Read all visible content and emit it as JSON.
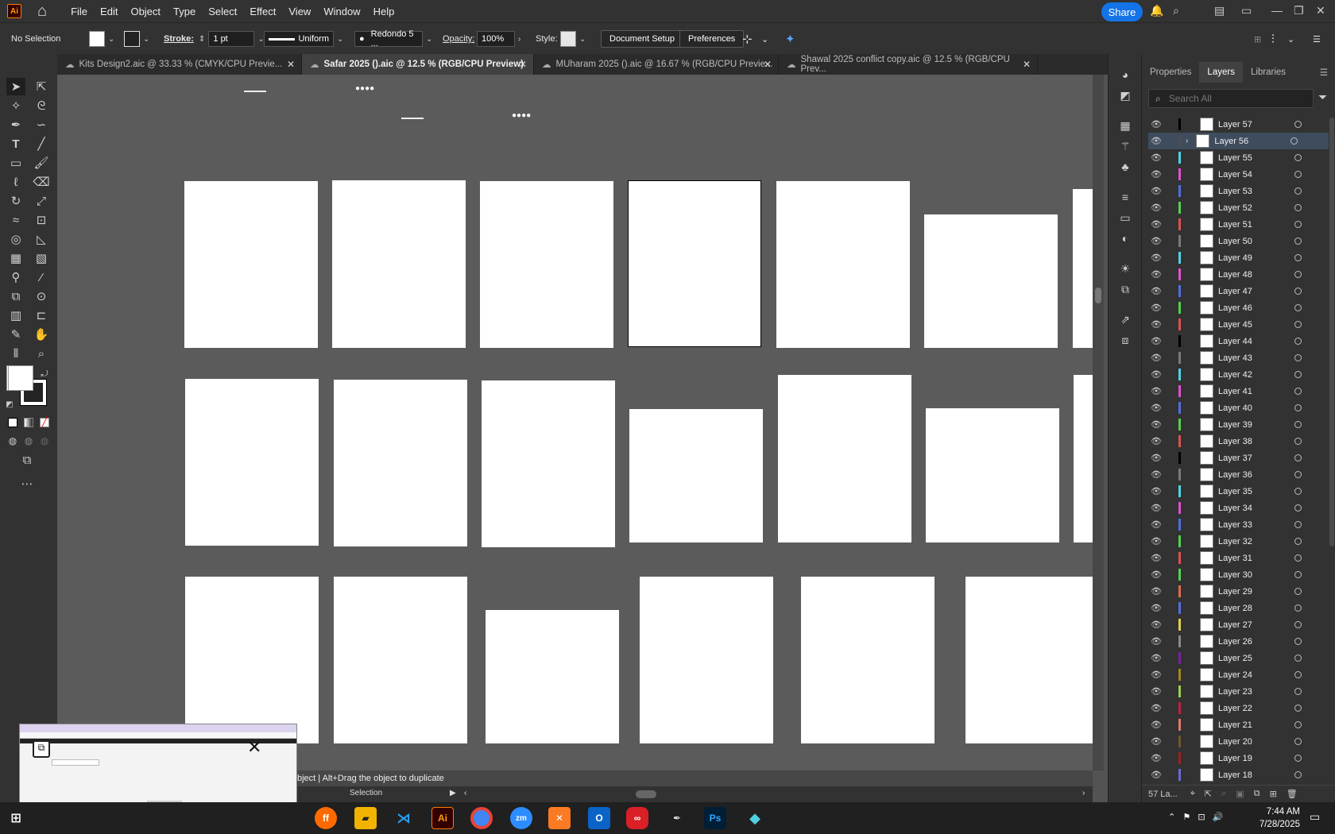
{
  "menubar": {
    "app_logo": "Ai",
    "items": [
      "File",
      "Edit",
      "Object",
      "Type",
      "Select",
      "Effect",
      "View",
      "Window",
      "Help"
    ],
    "share_label": "Share"
  },
  "control": {
    "selection": "No Selection",
    "stroke_label": "Stroke:",
    "stroke_value": "1 pt",
    "profile": "Uniform",
    "brush": "Redondo 5 ...",
    "opacity_label": "Opacity:",
    "opacity_value": "100%",
    "style_label": "Style:",
    "doc_setup": "Document Setup",
    "preferences": "Preferences"
  },
  "tabs": [
    {
      "label": "Kits Design2.aic @ 33.33 % (CMYK/CPU Previe...",
      "active": false
    },
    {
      "label": "Safar 2025 ().aic @ 12.5 % (RGB/CPU Preview)",
      "active": true
    },
    {
      "label": "MUharam 2025 ().aic @ 16.67 % (RGB/CPU Previe...",
      "active": false
    },
    {
      "label": "Shawal 2025 conflict copy.aic @ 12.5 % (RGB/CPU Prev...",
      "active": false
    }
  ],
  "panel": {
    "tabs": [
      "Properties",
      "Layers",
      "Libraries"
    ],
    "active_tab": "Layers",
    "search_placeholder": "Search All",
    "footer": "57 La...",
    "layers": [
      {
        "name": "Layer 57",
        "color": "#000000"
      },
      {
        "name": "Layer 56",
        "color": "#4d4d4d",
        "selected": true
      },
      {
        "name": "Layer 55",
        "color": "#4fd3e8"
      },
      {
        "name": "Layer 54",
        "color": "#e04fd3"
      },
      {
        "name": "Layer 53",
        "color": "#4f6fe0"
      },
      {
        "name": "Layer 52",
        "color": "#55d04f"
      },
      {
        "name": "Layer 51",
        "color": "#e04f4f"
      },
      {
        "name": "Layer 50",
        "color": "#7a7a7a"
      },
      {
        "name": "Layer 49",
        "color": "#4fd3e8"
      },
      {
        "name": "Layer 48",
        "color": "#e04fd3"
      },
      {
        "name": "Layer 47",
        "color": "#4f6fe0"
      },
      {
        "name": "Layer 46",
        "color": "#55d04f"
      },
      {
        "name": "Layer 45",
        "color": "#e04f4f"
      },
      {
        "name": "Layer 44",
        "color": "#000000"
      },
      {
        "name": "Layer 43",
        "color": "#7a7a7a"
      },
      {
        "name": "Layer 42",
        "color": "#4fd3e8"
      },
      {
        "name": "Layer 41",
        "color": "#e04fd3"
      },
      {
        "name": "Layer 40",
        "color": "#4f6fe0"
      },
      {
        "name": "Layer 39",
        "color": "#55d04f"
      },
      {
        "name": "Layer 38",
        "color": "#e04f4f"
      },
      {
        "name": "Layer 37",
        "color": "#000000"
      },
      {
        "name": "Layer 36",
        "color": "#7a7a7a"
      },
      {
        "name": "Layer 35",
        "color": "#4fd3e8"
      },
      {
        "name": "Layer 34",
        "color": "#e04fd3"
      },
      {
        "name": "Layer 33",
        "color": "#4f6fe0"
      },
      {
        "name": "Layer 32",
        "color": "#55d04f"
      },
      {
        "name": "Layer 31",
        "color": "#e04f4f"
      },
      {
        "name": "Layer 30",
        "color": "#55d04f"
      },
      {
        "name": "Layer 29",
        "color": "#e06a4f"
      },
      {
        "name": "Layer 28",
        "color": "#4f6fe0"
      },
      {
        "name": "Layer 27",
        "color": "#e0d04f"
      },
      {
        "name": "Layer 26",
        "color": "#8a8a8a"
      },
      {
        "name": "Layer 25",
        "color": "#7a1fa0"
      },
      {
        "name": "Layer 24",
        "color": "#a08a1f"
      },
      {
        "name": "Layer 23",
        "color": "#9ad04f"
      },
      {
        "name": "Layer 22",
        "color": "#c02040"
      },
      {
        "name": "Layer 21",
        "color": "#e07a6a"
      },
      {
        "name": "Layer 20",
        "color": "#6a5a2a"
      },
      {
        "name": "Layer 19",
        "color": "#a01f1f"
      },
      {
        "name": "Layer 18",
        "color": "#6a6ad0"
      }
    ]
  },
  "status": {
    "hint": "bject  |  Alt+Drag the object to duplicate",
    "tool": "Selection"
  },
  "taskbar": {
    "apps": [
      "Firefox",
      "Files",
      "VS Code",
      "Ai",
      "Chrome",
      "Zoom",
      "XAMPP",
      "Outlook",
      "Creative Cloud",
      "Pen",
      "Ps",
      "App"
    ],
    "time": "7:44 AM",
    "date": "7/28/2025"
  },
  "colors": {
    "accent": "#1473e6",
    "ui_bg": "#323232",
    "canvas": "#5b5b5b"
  }
}
